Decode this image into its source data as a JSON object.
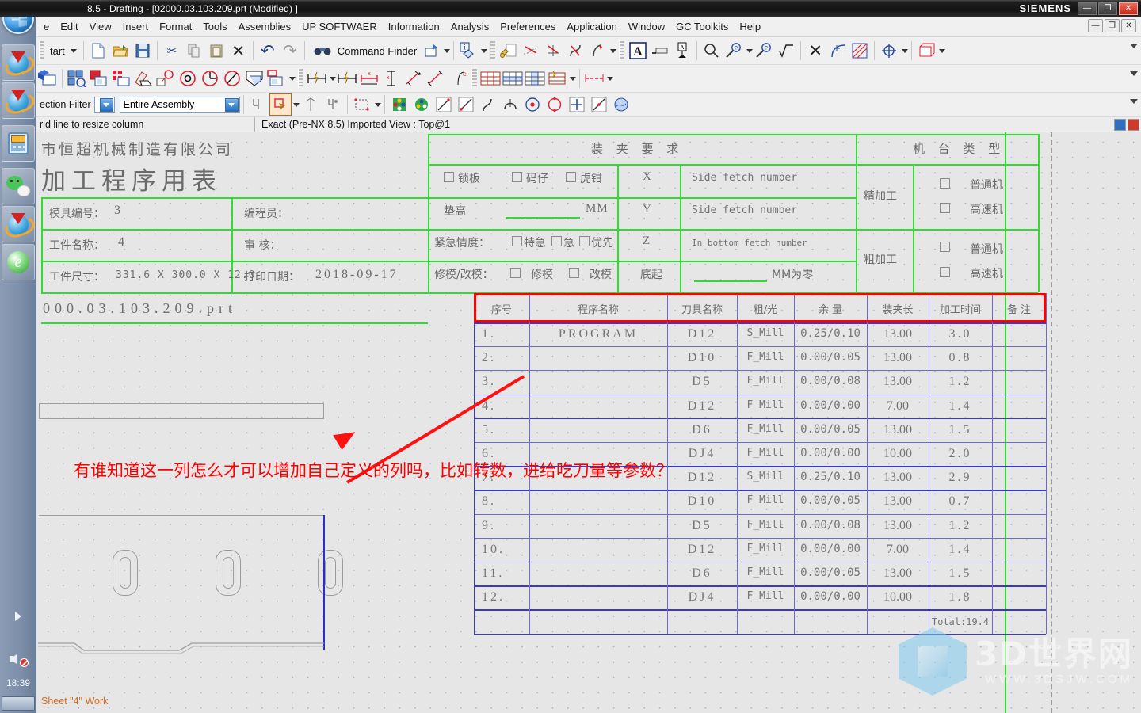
{
  "titlebar": {
    "text": "8.5 - Drafting - [02000.03.103.209.prt (Modified) ]",
    "brand": "SIEMENS",
    "minimize": "—",
    "restore": "❐",
    "close": "✕"
  },
  "menubar": {
    "items": [
      "e",
      "Edit",
      "View",
      "Insert",
      "Format",
      "Tools",
      "Assemblies",
      "UP SOFTWAER",
      "Information",
      "Analysis",
      "Preferences",
      "Application",
      "Window",
      "GC Toolkits",
      "Help"
    ],
    "mdi": [
      "—",
      "❐",
      "✕"
    ]
  },
  "toolbar1": {
    "start_label": "tart",
    "command_finder": "Command Finder",
    "icons": [
      "new-document-icon",
      "open-folder-icon",
      "save-icon",
      "cut-icon",
      "copy-icon",
      "paste-icon",
      "delete-icon",
      "undo-icon",
      "redo-icon",
      "binoculars-icon",
      "journal-icon",
      "info-icon",
      "wrench-icon",
      "trim-icon",
      "extend-icon",
      "corner-icon",
      "fillet-icon",
      "text-icon",
      "note-icon",
      "balloon-icon",
      "zoom-out-icon",
      "zoom-fit-icon",
      "zoom-in-icon",
      "radical-icon",
      "intersect-icon",
      "tangent-icon",
      "hatch-icon",
      "target-icon",
      "sheet-icon"
    ]
  },
  "toolbar2": {
    "icons": [
      "view-create-icon",
      "base-view-icon",
      "section-view-icon",
      "detail-view-icon",
      "break-view-icon",
      "projected-view-icon",
      "circle-dim-icon",
      "radius-dim-icon",
      "angular-dim-icon",
      "section-line-icon",
      "drawing-sheet-icon",
      "rapid-dim-icon",
      "linear-dim-icon",
      "horizontal-dim-icon",
      "vertical-dim-icon",
      "chamfer-dim-icon",
      "ordinate-dim-icon",
      "table-icon",
      "table-row-icon",
      "table-col-icon",
      "part-list-icon",
      "note-tools-icon",
      "center-mark-icon"
    ]
  },
  "toolbar3": {
    "selection_filter_label": "ection Filter",
    "scope_value": "Entire Assembly",
    "icons": [
      "select-general-icon",
      "select-feature-icon",
      "datum-icon",
      "snap-point-icon",
      "rectangle-select-icon",
      "face-color-icon",
      "object-display-icon",
      "line-create-icon",
      "line-2-icon",
      "spline-icon",
      "arc-icon",
      "circle-center-icon",
      "circle-icon",
      "point-icon",
      "line-icon",
      "fill-icon"
    ]
  },
  "status": {
    "hint": "rid line to resize column",
    "view_info": "Exact (Pre-NX 8.5) Imported View : Top@1"
  },
  "sheet": {
    "company": "市恒超机械制造有限公司",
    "title": "加工程序用表",
    "fields": [
      {
        "label": "模具编号：",
        "value": "3"
      },
      {
        "label": "编程员：",
        "value": ""
      },
      {
        "label": "工件名称：",
        "value": "4"
      },
      {
        "label": "审 核：",
        "value": ""
      },
      {
        "label": "工件尺寸：",
        "value": "331.6 X 300.0 X 12.0"
      },
      {
        "label": "打印日期：",
        "value": "2018-09-17"
      }
    ],
    "filename": "000.03.103.209.prt",
    "clamp": {
      "heading": "装 夹 要 求",
      "row1_checks": [
        "锁板",
        "码仔",
        "虎钳"
      ],
      "row2_label": "垫高",
      "row2_unit": "MM",
      "row3_label": "紧急情度：",
      "row3_checks": [
        "特急",
        "急",
        "优先"
      ],
      "row4_label": "修模/改模：",
      "row4_checks": [
        "修模",
        "改模"
      ]
    },
    "axes": [
      {
        "axis": "X",
        "value": "Side fetch number"
      },
      {
        "axis": "Y",
        "value": "Side fetch number"
      },
      {
        "axis": "Z",
        "value": "In bottom fetch number"
      },
      {
        "axis": "底起",
        "value": "MM为零"
      }
    ],
    "machine": {
      "heading": "机 台 类 型",
      "groups": [
        {
          "label": "精加工",
          "options": [
            "普通机",
            "高速机"
          ]
        },
        {
          "label": "粗加工",
          "options": [
            "普通机",
            "高速机"
          ]
        }
      ]
    }
  },
  "program_table": {
    "headers": [
      "序号",
      "程序名称",
      "刀具名称",
      "粗/光",
      "余 量",
      "装夹长",
      "加工时间",
      "备 注"
    ],
    "rows": [
      {
        "no": "1.",
        "program": "PROGRAM",
        "tool": "D12",
        "type": "S_Mill",
        "allowance": "0.25/0.10",
        "clamp_len": "13.00",
        "time": "3.0",
        "remark": ""
      },
      {
        "no": "2.",
        "program": "",
        "tool": "D10",
        "type": "F_Mill",
        "allowance": "0.00/0.05",
        "clamp_len": "13.00",
        "time": "0.8",
        "remark": ""
      },
      {
        "no": "3.",
        "program": "",
        "tool": "D5",
        "type": "F_Mill",
        "allowance": "0.00/0.08",
        "clamp_len": "13.00",
        "time": "1.2",
        "remark": ""
      },
      {
        "no": "4.",
        "program": "",
        "tool": "D12",
        "type": "F_Mill",
        "allowance": "0.00/0.00",
        "clamp_len": "7.00",
        "time": "1.4",
        "remark": ""
      },
      {
        "no": "5.",
        "program": "",
        "tool": "D6",
        "type": "F_Mill",
        "allowance": "0.00/0.05",
        "clamp_len": "13.00",
        "time": "1.5",
        "remark": ""
      },
      {
        "no": "6.",
        "program": "",
        "tool": "DJ4",
        "type": "F_Mill",
        "allowance": "0.00/0.00",
        "clamp_len": "10.00",
        "time": "2.0",
        "remark": ""
      },
      {
        "no": "7.",
        "program": "",
        "tool": "D12",
        "type": "S_Mill",
        "allowance": "0.25/0.10",
        "clamp_len": "13.00",
        "time": "2.9",
        "remark": ""
      },
      {
        "no": "8.",
        "program": "",
        "tool": "D10",
        "type": "F_Mill",
        "allowance": "0.00/0.05",
        "clamp_len": "13.00",
        "time": "0.7",
        "remark": ""
      },
      {
        "no": "9.",
        "program": "",
        "tool": "D5",
        "type": "F_Mill",
        "allowance": "0.00/0.08",
        "clamp_len": "13.00",
        "time": "1.2",
        "remark": ""
      },
      {
        "no": "10.",
        "program": "",
        "tool": "D12",
        "type": "F_Mill",
        "allowance": "0.00/0.00",
        "clamp_len": "7.00",
        "time": "1.4",
        "remark": ""
      },
      {
        "no": "11.",
        "program": "",
        "tool": "D6",
        "type": "F_Mill",
        "allowance": "0.00/0.05",
        "clamp_len": "13.00",
        "time": "1.5",
        "remark": ""
      },
      {
        "no": "12.",
        "program": "",
        "tool": "DJ4",
        "type": "F_Mill",
        "allowance": "0.00/0.00",
        "clamp_len": "10.00",
        "time": "1.8",
        "remark": ""
      }
    ],
    "total": "Total:19.4"
  },
  "annotation": {
    "text": "有谁知道这一列怎么才可以增加自己定义的列吗，比如转数，进给吃刀量等参数？",
    "color": "#ff0000"
  },
  "sheet_label": "Sheet \"4\" Work",
  "taskbar": {
    "clock": "18:39",
    "items": [
      "idm-download-icon",
      "idm-download-icon",
      "calculator-icon",
      "wechat-icon",
      "idm-download-icon",
      "ie-browser-icon"
    ],
    "tray": [
      "tray-expand-icon",
      "volume-mute-icon"
    ]
  },
  "watermark": {
    "text": "3D世界网",
    "url": "WWW.3DSJW.COM"
  }
}
